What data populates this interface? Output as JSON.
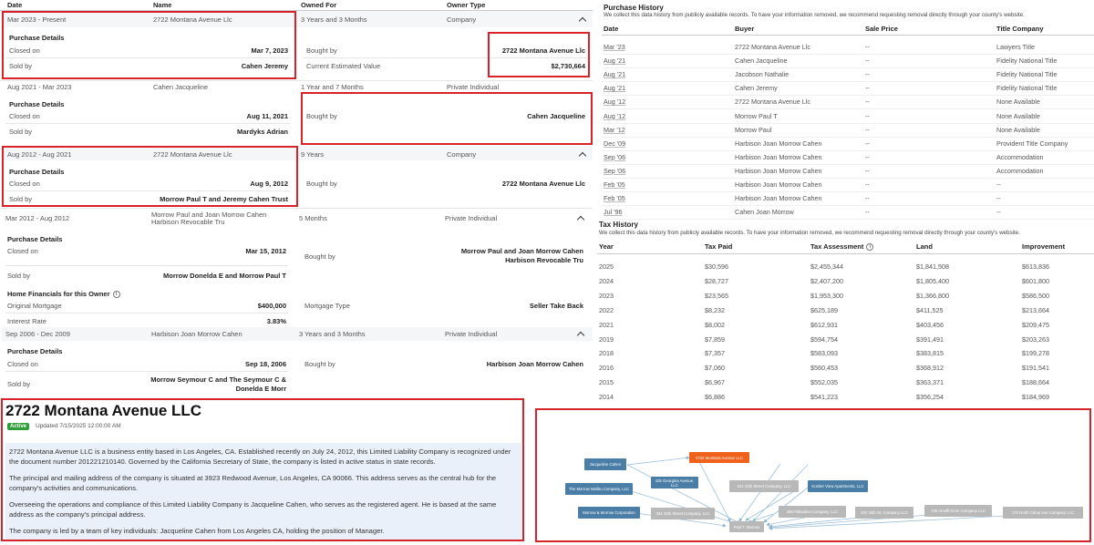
{
  "ownership": {
    "headers": {
      "date": "Date",
      "name": "Name",
      "owned_for": "Owned For",
      "owner_type": "Owner Type"
    },
    "labels": {
      "purchase_details": "Purchase Details",
      "closed_on": "Closed on",
      "sold_by": "Sold by",
      "bought_by": "Bought by",
      "current_value": "Current Estimated Value",
      "home_financials": "Home Financials for this Owner",
      "original_mortgage": "Original Mortgage",
      "mortgage_type": "Mortgage Type",
      "interest_rate": "Interest Rate"
    },
    "owners": [
      {
        "date": "Mar 2023 - Present",
        "name": "2722 Montana Avenue Llc",
        "owned_for": "3 Years and 3 Months",
        "type": "Company",
        "closed_on": "Mar 7, 2023",
        "sold_by": "Cahen Jeremy",
        "bought_by": "2722 Montana Avenue Llc",
        "current_value": "$2,730,664"
      },
      {
        "date": "Aug 2021 - Mar 2023",
        "name": "Cahen Jacqueline",
        "owned_for": "1 Year and 7 Months",
        "type": "Private Individual",
        "closed_on": "Aug 11, 2021",
        "sold_by": "Mardyks Adrian",
        "bought_by": "Cahen Jacqueline"
      },
      {
        "date": "Aug 2012 - Aug 2021",
        "name": "2722 Montana Avenue Llc",
        "owned_for": "9 Years",
        "type": "Company",
        "closed_on": "Aug 9, 2012",
        "sold_by": "Morrow Paul T and Jeremy Cahen Trust",
        "bought_by": "2722 Montana Avenue Llc"
      },
      {
        "date": "Mar 2012 - Aug 2012",
        "name_line1": "Morrow Paul and Joan Morrow Cahen",
        "name_line2": "Harbison Revocable Tru",
        "owned_for": "5 Months",
        "type": "Private Individual",
        "closed_on": "Mar 15, 2012",
        "sold_by": "Morrow Donelda E and Morrow Paul T",
        "bought_by_line1": "Morrow Paul and Joan Morrow Cahen",
        "bought_by_line2": "Harbison Revocable Tru",
        "original_mortgage": "$400,000",
        "mortgage_type": "Seller Take Back",
        "interest_rate": "3.83%"
      },
      {
        "date": "Sep 2006 - Dec 2009",
        "name": "Harbison Joan Morrow Cahen",
        "owned_for": "3 Years and 3 Months",
        "type": "Private Individual",
        "closed_on": "Sep 18, 2006",
        "sold_by_line1": "Morrow Seymour C and The Seymour C &",
        "sold_by_line2": "Donelda E Morr",
        "bought_by": "Harbison Joan Morrow Cahen"
      }
    ]
  },
  "purchase_history": {
    "title": "Purchase History",
    "subtitle": "We collect this data history from publicly available records.  To have your information removed, we recommend requesting removal directly through your county's website.",
    "headers": {
      "date": "Date",
      "buyer": "Buyer",
      "sale_price": "Sale Price",
      "title_company": "Title Company"
    },
    "rows": [
      {
        "date": "Mar '23",
        "buyer": "2722 Montana Avenue Llc",
        "price": "--",
        "title": "Lawyers Title"
      },
      {
        "date": "Aug '21",
        "buyer": "Cahen Jacqueline",
        "price": "--",
        "title": "Fidelity National Title"
      },
      {
        "date": "Aug '21",
        "buyer": "Jacobson Nathalie",
        "price": "--",
        "title": "Fidelity National Title"
      },
      {
        "date": "Aug '21",
        "buyer": "Cahen Jeremy",
        "price": "--",
        "title": "Fidelity National Title"
      },
      {
        "date": "Aug '12",
        "buyer": "2722 Montana Avenue Llc",
        "price": "--",
        "title": "None Available"
      },
      {
        "date": "Aug '12",
        "buyer": "Morrow Paul T",
        "price": "--",
        "title": "None Available"
      },
      {
        "date": "Mar '12",
        "buyer": "Morrow Paul",
        "price": "--",
        "title": "None Available"
      },
      {
        "date": "Dec '09",
        "buyer": "Harbison Joan Morrow Cahen",
        "price": "--",
        "title": "Provident Title Company"
      },
      {
        "date": "Sep '06",
        "buyer": "Harbison Joan Morrow Cahen",
        "price": "--",
        "title": "Accommodation"
      },
      {
        "date": "Sep '06",
        "buyer": "Harbison Joan Morrow Cahen",
        "price": "--",
        "title": "Accommodation"
      },
      {
        "date": "Feb '05",
        "buyer": "Harbison Joan Morrow Cahen",
        "price": "--",
        "title": "--"
      },
      {
        "date": "Feb '05",
        "buyer": "Harbison Joan Morrow Cahen",
        "price": "--",
        "title": "--"
      },
      {
        "date": "Jul '96",
        "buyer": "Cahen Joan Morrow",
        "price": "--",
        "title": "--"
      }
    ]
  },
  "tax_history": {
    "title": "Tax History",
    "subtitle": "We collect this data history from publicly available records.  To have your information removed, we recommend requesting removal directly through your county's website.",
    "headers": {
      "year": "Year",
      "tax_paid": "Tax Paid",
      "assessment": "Tax Assessment",
      "land": "Land",
      "improvement": "Improvement"
    },
    "rows": [
      {
        "year": "2025",
        "tax": "$30,596",
        "assessment": "$2,455,344",
        "land": "$1,841,508",
        "improvement": "$613,836"
      },
      {
        "year": "2024",
        "tax": "$28,727",
        "assessment": "$2,407,200",
        "land": "$1,805,400",
        "improvement": "$601,800"
      },
      {
        "year": "2023",
        "tax": "$23,565",
        "assessment": "$1,953,300",
        "land": "$1,366,800",
        "improvement": "$586,500"
      },
      {
        "year": "2022",
        "tax": "$8,232",
        "assessment": "$625,189",
        "land": "$411,525",
        "improvement": "$213,664"
      },
      {
        "year": "2021",
        "tax": "$8,002",
        "assessment": "$612,931",
        "land": "$403,456",
        "improvement": "$209,475"
      },
      {
        "year": "2019",
        "tax": "$7,859",
        "assessment": "$594,754",
        "land": "$391,491",
        "improvement": "$203,263"
      },
      {
        "year": "2018",
        "tax": "$7,357",
        "assessment": "$583,093",
        "land": "$383,815",
        "improvement": "$199,278"
      },
      {
        "year": "2016",
        "tax": "$7,060",
        "assessment": "$560,453",
        "land": "$368,912",
        "improvement": "$191,541"
      },
      {
        "year": "2015",
        "tax": "$6,967",
        "assessment": "$552,035",
        "land": "$363,371",
        "improvement": "$188,664"
      },
      {
        "year": "2014",
        "tax": "$6,886",
        "assessment": "$541,223",
        "land": "$356,254",
        "improvement": "$184,969"
      }
    ]
  },
  "company": {
    "title": "2722 Montana Avenue LLC",
    "status": "Active",
    "updated": "Updated 7/15/2025 12:00:00 AM",
    "paragraphs": [
      "2722 Montana Avenue LLC is a business entity based in Los Angeles, CA. Established recently on July 24, 2012, this Limited Liability Company is recognized under the document number 201221210140. Governed by the California Secretary of State, the company is listed in active status in state records.",
      "The principal and mailing address of the company is situated at 3923 Redwood Avenue, Los Angeles, CA 90066. This address serves as the central hub for the company's activities and communications.",
      "Overseeing the operations and compliance of this Limited Liability Company is Jacqueline Cahen, who serves as the registered agent. He is based at the same address as the company's principal address.",
      "The company is led by a team of key individuals: Jacqueline Cahen from Los Angeles CA, holding the position of Manager."
    ]
  },
  "network_graph": {
    "nodes": [
      {
        "id": "center",
        "label": "2722 Montana Avenue LLC",
        "kind": "focus",
        "color": "#f0611c"
      },
      {
        "id": "jc",
        "label": "Jacqueline Cahen",
        "kind": "person",
        "color": "#4a7ea6"
      },
      {
        "id": "georgina",
        "label": "425 Georgina Avenue, LLC",
        "kind": "company-linked",
        "color": "#4a7ea6"
      },
      {
        "id": "malibu",
        "label": "The Morrow Malibu Company, LLC",
        "kind": "company-linked",
        "color": "#4a7ea6"
      },
      {
        "id": "mmcorp",
        "label": "Morrow & Morrow Corporation",
        "kind": "company-linked",
        "color": "#4a7ea6"
      },
      {
        "id": "kosher",
        "label": "Kosher View Apartments, LLC",
        "kind": "company-linked",
        "color": "#4a7ea6"
      },
      {
        "id": "s24",
        "label": "221 24th Street Company, LLC",
        "kind": "company",
        "color": "#b8b8b8"
      },
      {
        "id": "s15",
        "label": "334 15th Street Company, LLC",
        "kind": "company",
        "color": "#b8b8b8"
      },
      {
        "id": "pali",
        "label": "495 Palisades Company, LLC",
        "kind": "company",
        "color": "#b8b8b8"
      },
      {
        "id": "s25",
        "label": "402 25th St. Company LLC",
        "kind": "company",
        "color": "#b8b8b8"
      },
      {
        "id": "amalfi",
        "label": "735 Amalfi Drive Company LLC",
        "kind": "company",
        "color": "#b8b8b8"
      },
      {
        "id": "citrus",
        "label": "170 North Citrus Ave Company LLC",
        "kind": "company",
        "color": "#b8b8b8"
      },
      {
        "id": "paul",
        "label": "Paul T. Morrow",
        "kind": "person",
        "color": "#b8b8b8"
      }
    ]
  }
}
